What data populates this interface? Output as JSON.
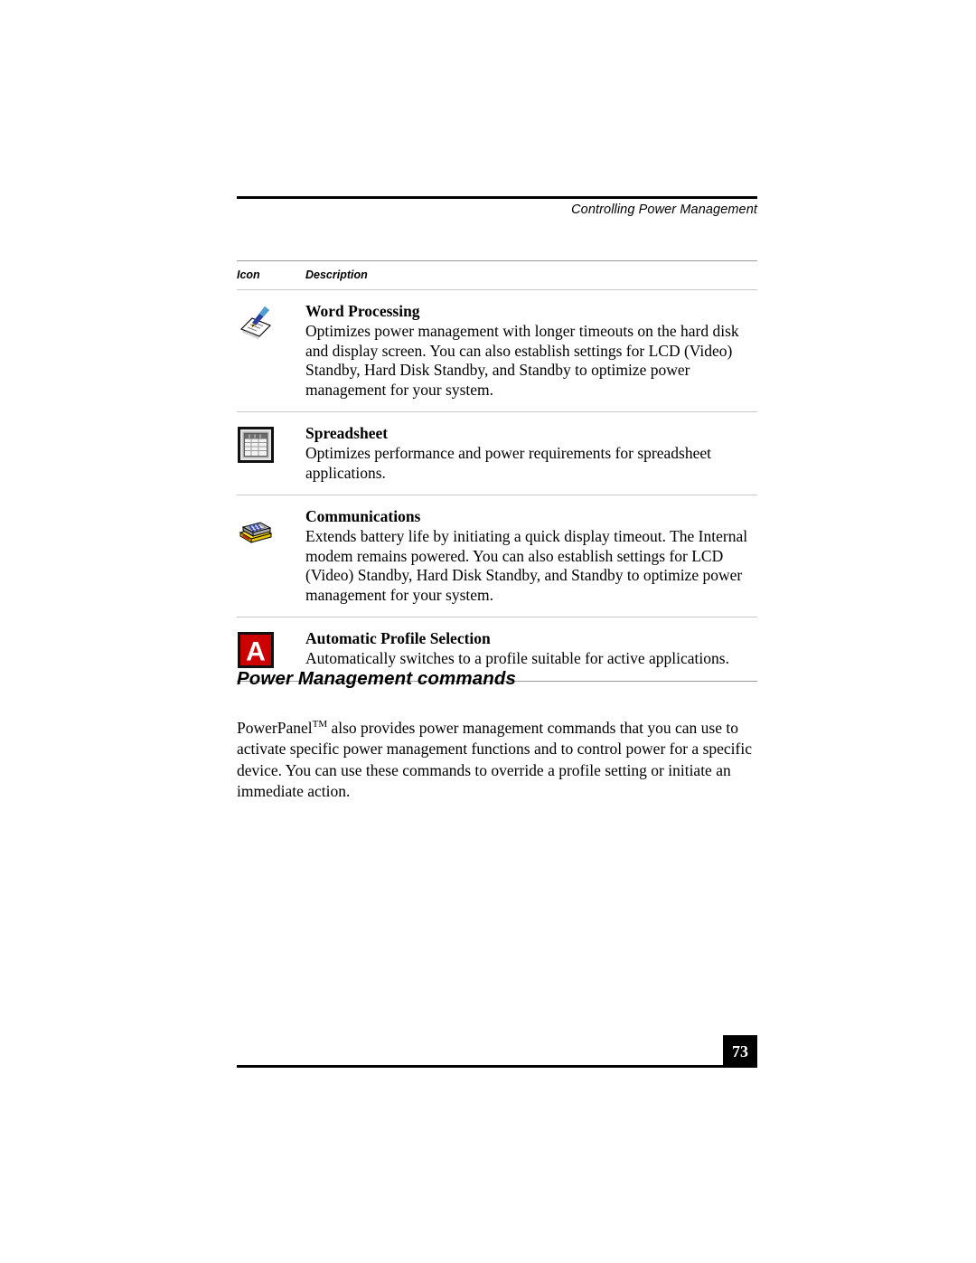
{
  "header": {
    "running_title": "Controlling Power Management"
  },
  "table": {
    "columns": [
      "Icon",
      "Description"
    ],
    "rows": [
      {
        "icon_name": "word-processing-icon",
        "title": "Word Processing",
        "body": "Optimizes power management with longer timeouts on the hard disk and display screen. You can also establish settings for LCD (Video) Standby, Hard Disk Standby, and Standby to optimize power management for your system."
      },
      {
        "icon_name": "spreadsheet-icon",
        "title": "Spreadsheet",
        "body": "Optimizes performance and power requirements for spreadsheet applications."
      },
      {
        "icon_name": "communications-icon",
        "title": "Communications",
        "body": "Extends battery life by initiating a quick display timeout. The Internal modem remains powered. You can also establish settings for LCD (Video) Standby, Hard Disk Standby, and Standby to optimize power management for your system."
      },
      {
        "icon_name": "automatic-profile-selection-icon",
        "title": "Automatic Profile Selection",
        "body": "Automatically switches to a profile suitable for active applications."
      }
    ]
  },
  "section": {
    "heading": "Power Management commands",
    "paragraph_before_tm": "PowerPanel",
    "paragraph_tm": "TM",
    "paragraph_after_tm": " also provides power management commands that you can use to activate specific power management functions and to control power for a specific device. You can use these commands to override a profile setting or initiate an immediate action."
  },
  "footer": {
    "page_number": "73"
  },
  "colors": {
    "rule_black": "#000000",
    "rule_gray": "#9a9a9a",
    "rule_gray_light": "#c9c9c9",
    "icon_red": "#cc0000",
    "icon_yellow": "#ffdd22",
    "icon_blue": "#2b3f9e",
    "page_background": "#ffffff"
  }
}
